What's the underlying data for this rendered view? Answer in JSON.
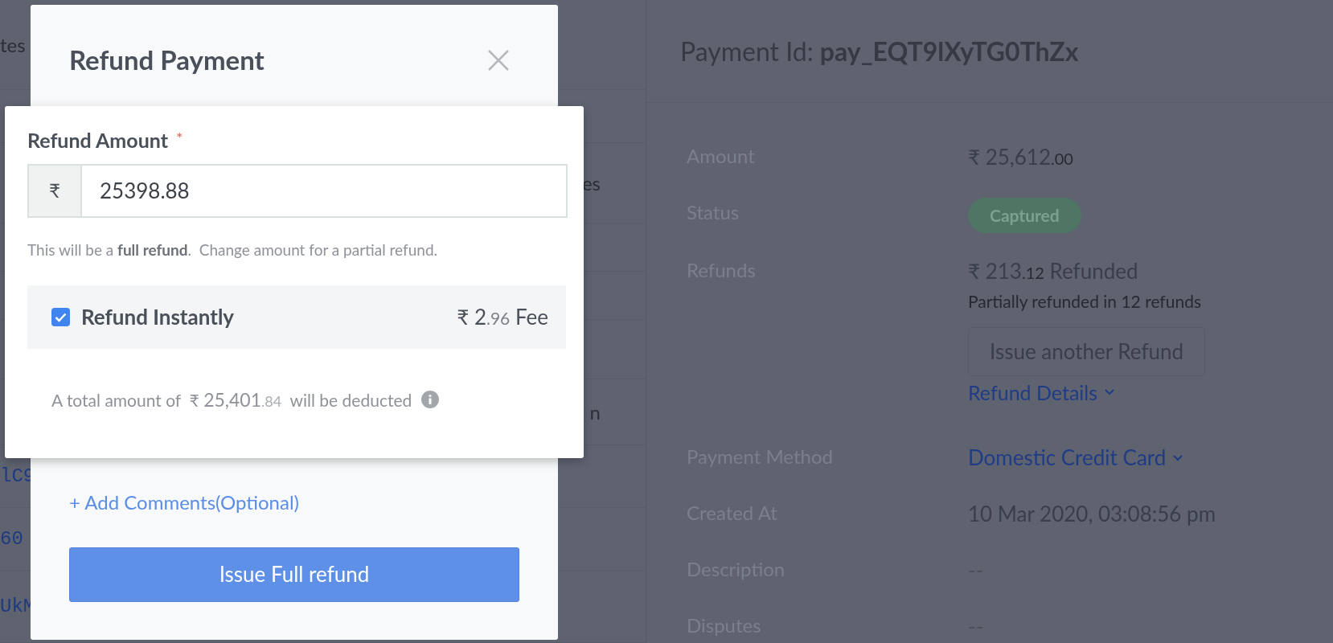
{
  "background_table": {
    "left_edge_cells": [
      "tes",
      "lC9",
      "60",
      "UkM"
    ],
    "right_edge_cells": [
      "es",
      "n"
    ]
  },
  "payment": {
    "title_label": "Payment Id:",
    "payment_id": "pay_EQT9lXyTG0ThZx",
    "amount": {
      "label": "Amount",
      "currency": "₹",
      "major": "25,612",
      "minor": ".00"
    },
    "status": {
      "label": "Status",
      "badge": "Captured"
    },
    "refunds": {
      "label": "Refunds",
      "currency": "₹",
      "major": "213",
      "minor": ".12",
      "suffix": "Refunded",
      "note": "Partially refunded in 12 refunds",
      "button": "Issue another Refund",
      "details_link": "Refund Details"
    },
    "method": {
      "label": "Payment Method",
      "value": "Domestic Credit Card"
    },
    "created": {
      "label": "Created At",
      "value": "10 Mar 2020, 03:08:56 pm"
    },
    "description": {
      "label": "Description",
      "value": "--"
    },
    "disputes": {
      "label": "Disputes",
      "value": "--"
    }
  },
  "modal": {
    "title": "Refund Payment",
    "amount_label": "Refund Amount",
    "required_mark": "*",
    "currency_prefix": "₹",
    "amount_value": "25398.88",
    "hint": "This will be a **full refund**.  Change amount for a partial refund.",
    "instant": {
      "label": "Refund Instantly",
      "checked": true,
      "currency": "₹",
      "major": "2",
      "minor": ".96",
      "suffix": "Fee"
    },
    "total": {
      "prefix": "A total amount of",
      "currency": "₹",
      "major": "25,401",
      "minor": ".84",
      "suffix": "will be deducted"
    },
    "add_comments": "+ Add Comments(Optional)",
    "submit": "Issue Full refund"
  }
}
